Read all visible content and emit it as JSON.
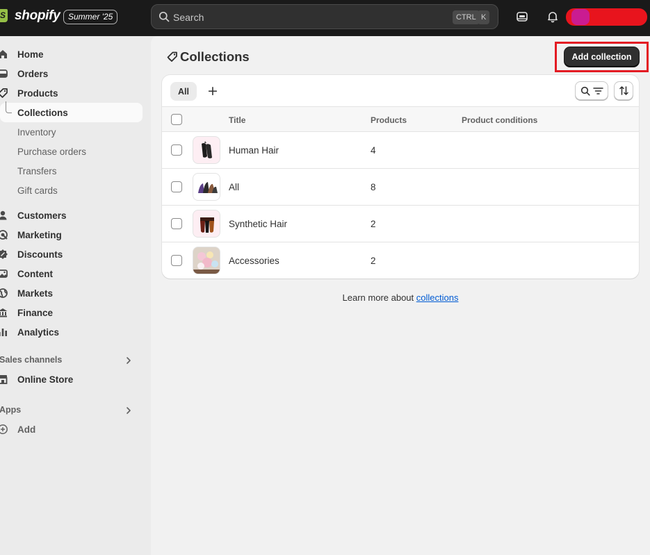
{
  "topbar": {
    "brand": "shopify",
    "edition": "Summer '25",
    "search": {
      "placeholder": "Search",
      "shortcut_ctrl": "CTRL",
      "shortcut_key": "K"
    }
  },
  "sidebar": {
    "items": [
      {
        "label": "Home",
        "icon": "home-icon"
      },
      {
        "label": "Orders",
        "icon": "orders-icon"
      },
      {
        "label": "Products",
        "icon": "tag-icon"
      }
    ],
    "product_subitems": [
      {
        "label": "Collections",
        "active": true
      },
      {
        "label": "Inventory",
        "active": false
      },
      {
        "label": "Purchase orders",
        "active": false
      },
      {
        "label": "Transfers",
        "active": false
      },
      {
        "label": "Gift cards",
        "active": false
      }
    ],
    "items2": [
      {
        "label": "Customers",
        "icon": "person-icon"
      },
      {
        "label": "Marketing",
        "icon": "target-icon"
      },
      {
        "label": "Discounts",
        "icon": "discount-icon"
      },
      {
        "label": "Content",
        "icon": "image-icon"
      },
      {
        "label": "Markets",
        "icon": "globe-icon"
      },
      {
        "label": "Finance",
        "icon": "bank-icon"
      },
      {
        "label": "Analytics",
        "icon": "bar-chart-icon"
      }
    ],
    "sales_channels": {
      "heading": "Sales channels",
      "items": [
        {
          "label": "Online Store",
          "icon": "storefront-icon"
        }
      ]
    },
    "apps": {
      "heading": "Apps",
      "add_label": "Add"
    }
  },
  "main": {
    "page_title": "Collections",
    "add_button": "Add collection",
    "tabs": {
      "all": "All",
      "add": "+"
    },
    "table": {
      "columns": [
        "Title",
        "Products",
        "Product conditions"
      ],
      "rows": [
        {
          "title": "Human Hair",
          "products": "4",
          "conditions": ""
        },
        {
          "title": "All",
          "products": "8",
          "conditions": ""
        },
        {
          "title": "Synthetic Hair",
          "products": "2",
          "conditions": ""
        },
        {
          "title": "Accessories",
          "products": "2",
          "conditions": ""
        }
      ]
    },
    "learn_more": {
      "prefix": "Learn more about ",
      "link": "collections"
    }
  },
  "colors": {
    "topbar": "#1a1a1a",
    "primary_button": "#303030",
    "link": "#005bd3",
    "highlight": "#e31b23",
    "redaction": "#e8141d"
  }
}
